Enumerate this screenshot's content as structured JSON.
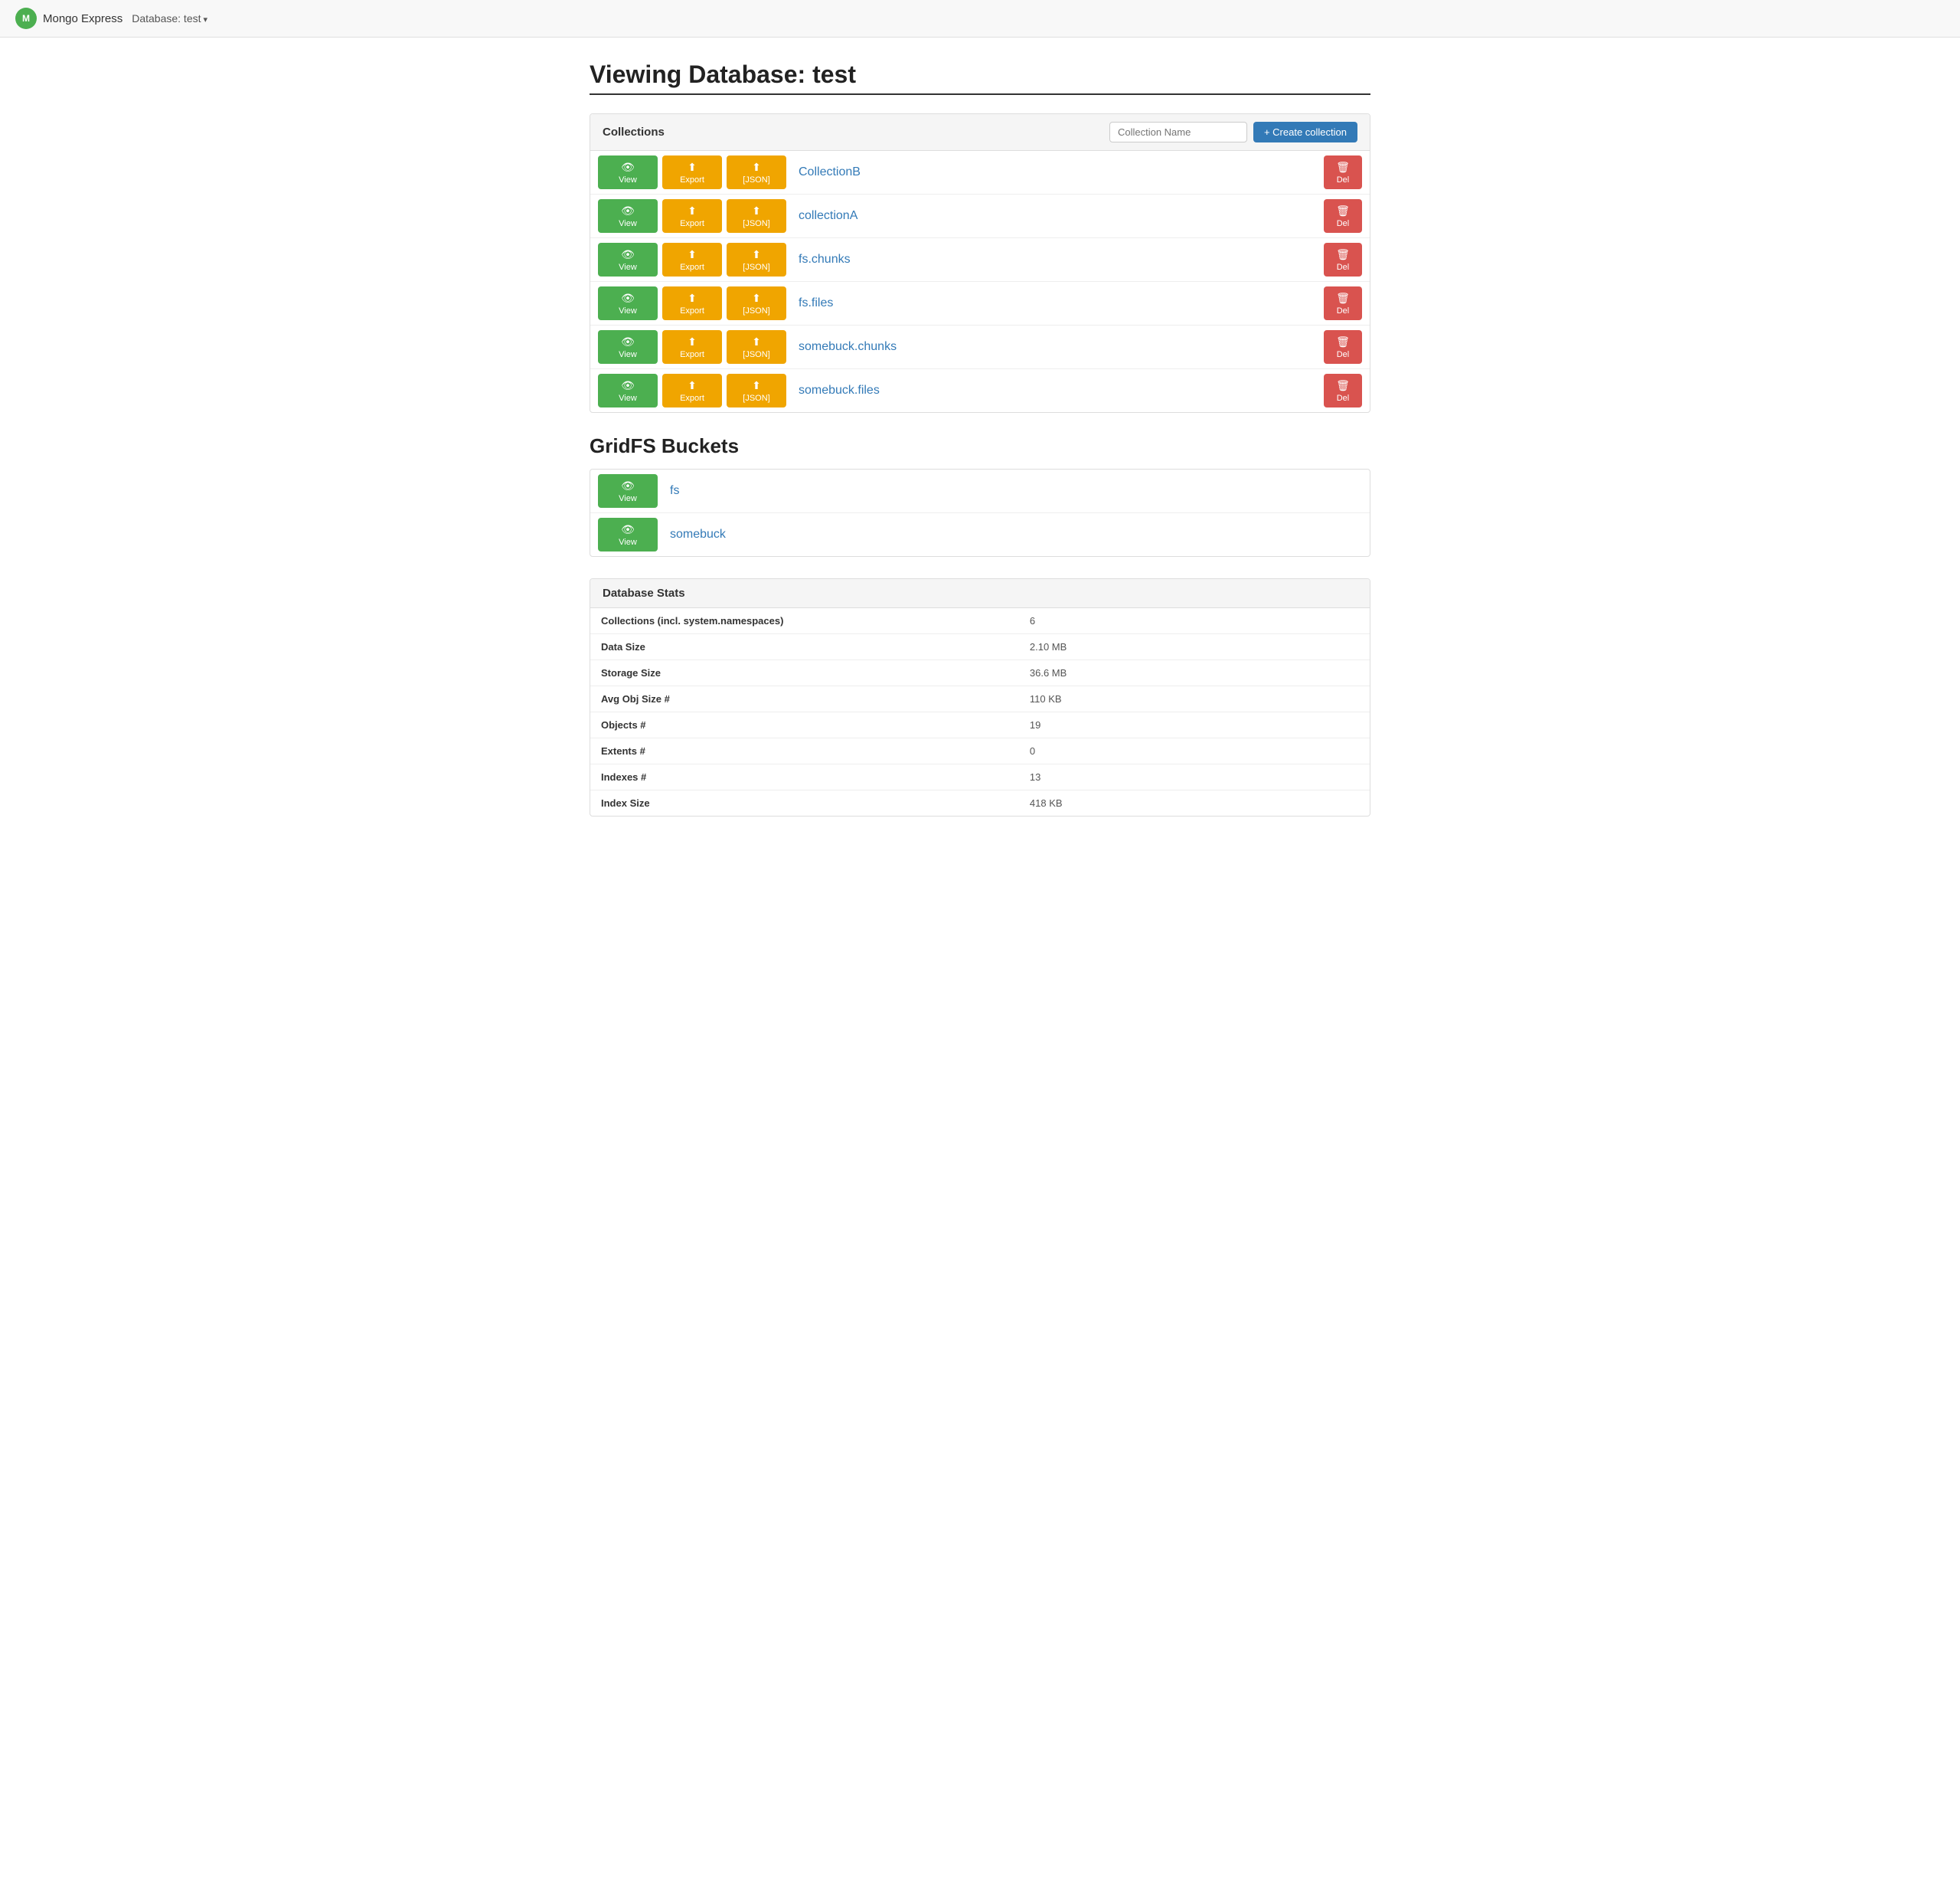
{
  "navbar": {
    "brand": "Mongo Express",
    "db_label": "Database: test"
  },
  "page": {
    "title": "Viewing Database: test"
  },
  "collections_panel": {
    "heading": "Collections",
    "input_placeholder": "Collection Name",
    "create_button_label": "+ Create collection",
    "rows": [
      {
        "name": "CollectionB",
        "view_label": "View",
        "export_label": "Export",
        "json_label": "[JSON]",
        "del_label": "Del"
      },
      {
        "name": "collectionA",
        "view_label": "View",
        "export_label": "Export",
        "json_label": "[JSON]",
        "del_label": "Del"
      },
      {
        "name": "fs.chunks",
        "view_label": "View",
        "export_label": "Export",
        "json_label": "[JSON]",
        "del_label": "Del"
      },
      {
        "name": "fs.files",
        "view_label": "View",
        "export_label": "Export",
        "json_label": "[JSON]",
        "del_label": "Del"
      },
      {
        "name": "somebuck.chunks",
        "view_label": "View",
        "export_label": "Export",
        "json_label": "[JSON]",
        "del_label": "Del"
      },
      {
        "name": "somebuck.files",
        "view_label": "View",
        "export_label": "Export",
        "json_label": "[JSON]",
        "del_label": "Del"
      }
    ]
  },
  "gridfs_section": {
    "title": "GridFS Buckets",
    "buckets": [
      {
        "name": "fs",
        "view_label": "View"
      },
      {
        "name": "somebuck",
        "view_label": "View"
      }
    ]
  },
  "stats_panel": {
    "heading": "Database Stats",
    "rows": [
      {
        "label": "Collections (incl. system.namespaces)",
        "value": "6"
      },
      {
        "label": "Data Size",
        "value": "2.10 MB"
      },
      {
        "label": "Storage Size",
        "value": "36.6 MB"
      },
      {
        "label": "Avg Obj Size #",
        "value": "110 KB"
      },
      {
        "label": "Objects #",
        "value": "19"
      },
      {
        "label": "Extents #",
        "value": "0"
      },
      {
        "label": "Indexes #",
        "value": "13"
      },
      {
        "label": "Index Size",
        "value": "418 KB"
      }
    ]
  },
  "colors": {
    "green": "#4CAF50",
    "orange": "#f0a500",
    "red": "#d9534f",
    "blue": "#337ab7"
  }
}
